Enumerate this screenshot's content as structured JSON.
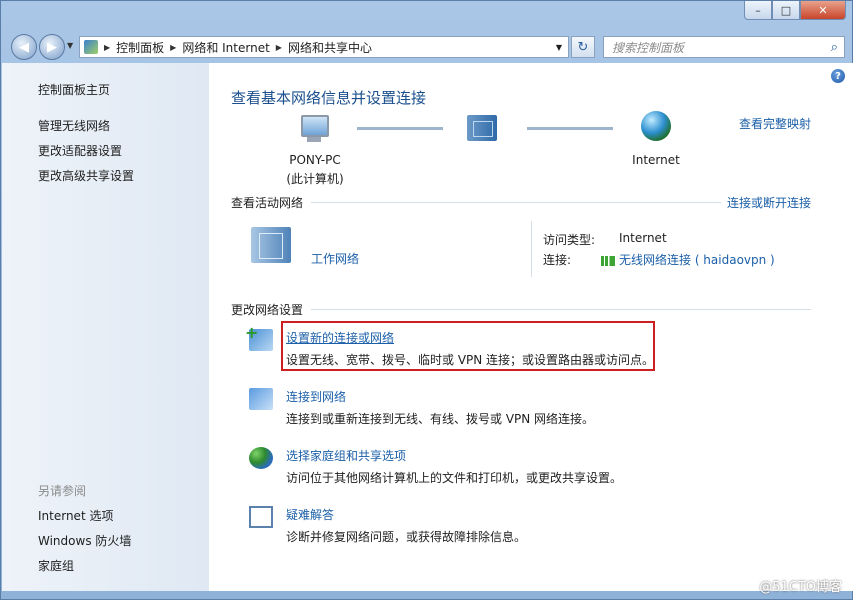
{
  "window": {
    "min": "–",
    "max": "□",
    "close": "✕"
  },
  "address": {
    "crumbs": [
      "控制面板",
      "网络和 Internet",
      "网络和共享中心"
    ],
    "search_placeholder": "搜索控制面板"
  },
  "sidebar": {
    "home": "控制面板主页",
    "items": [
      "管理无线网络",
      "更改适配器设置",
      "更改高级共享设置"
    ],
    "see_also_title": "另请参阅",
    "see_also": [
      "Internet 选项",
      "Windows 防火墙",
      "家庭组"
    ]
  },
  "main": {
    "title": "查看基本网络信息并设置连接",
    "full_map": "查看完整映射",
    "nodes": {
      "pc_name": "PONY-PC",
      "pc_sub": "(此计算机)",
      "internet": "Internet"
    },
    "active_title": "查看活动网络",
    "connect_disconnect": "连接或断开连接",
    "network_name": "工作网络",
    "access_type_label": "访问类型:",
    "access_type_value": "Internet",
    "connection_label": "连接:",
    "connection_value": "无线网络连接 ( haidaovpn )",
    "change_title": "更改网络设置",
    "tasks": [
      {
        "title": "设置新的连接或网络",
        "desc": "设置无线、宽带、拨号、临时或 VPN 连接；或设置路由器或访问点。"
      },
      {
        "title": "连接到网络",
        "desc": "连接到或重新连接到无线、有线、拨号或 VPN 网络连接。"
      },
      {
        "title": "选择家庭组和共享选项",
        "desc": "访问位于其他网络计算机上的文件和打印机，或更改共享设置。"
      },
      {
        "title": "疑难解答",
        "desc": "诊断并修复网络问题，或获得故障排除信息。"
      }
    ]
  },
  "watermark": "@51CTO博客",
  "colors": {
    "link": "#1b5fa8",
    "highlight_border": "#cc1f1f",
    "title": "#1b4f8d"
  }
}
